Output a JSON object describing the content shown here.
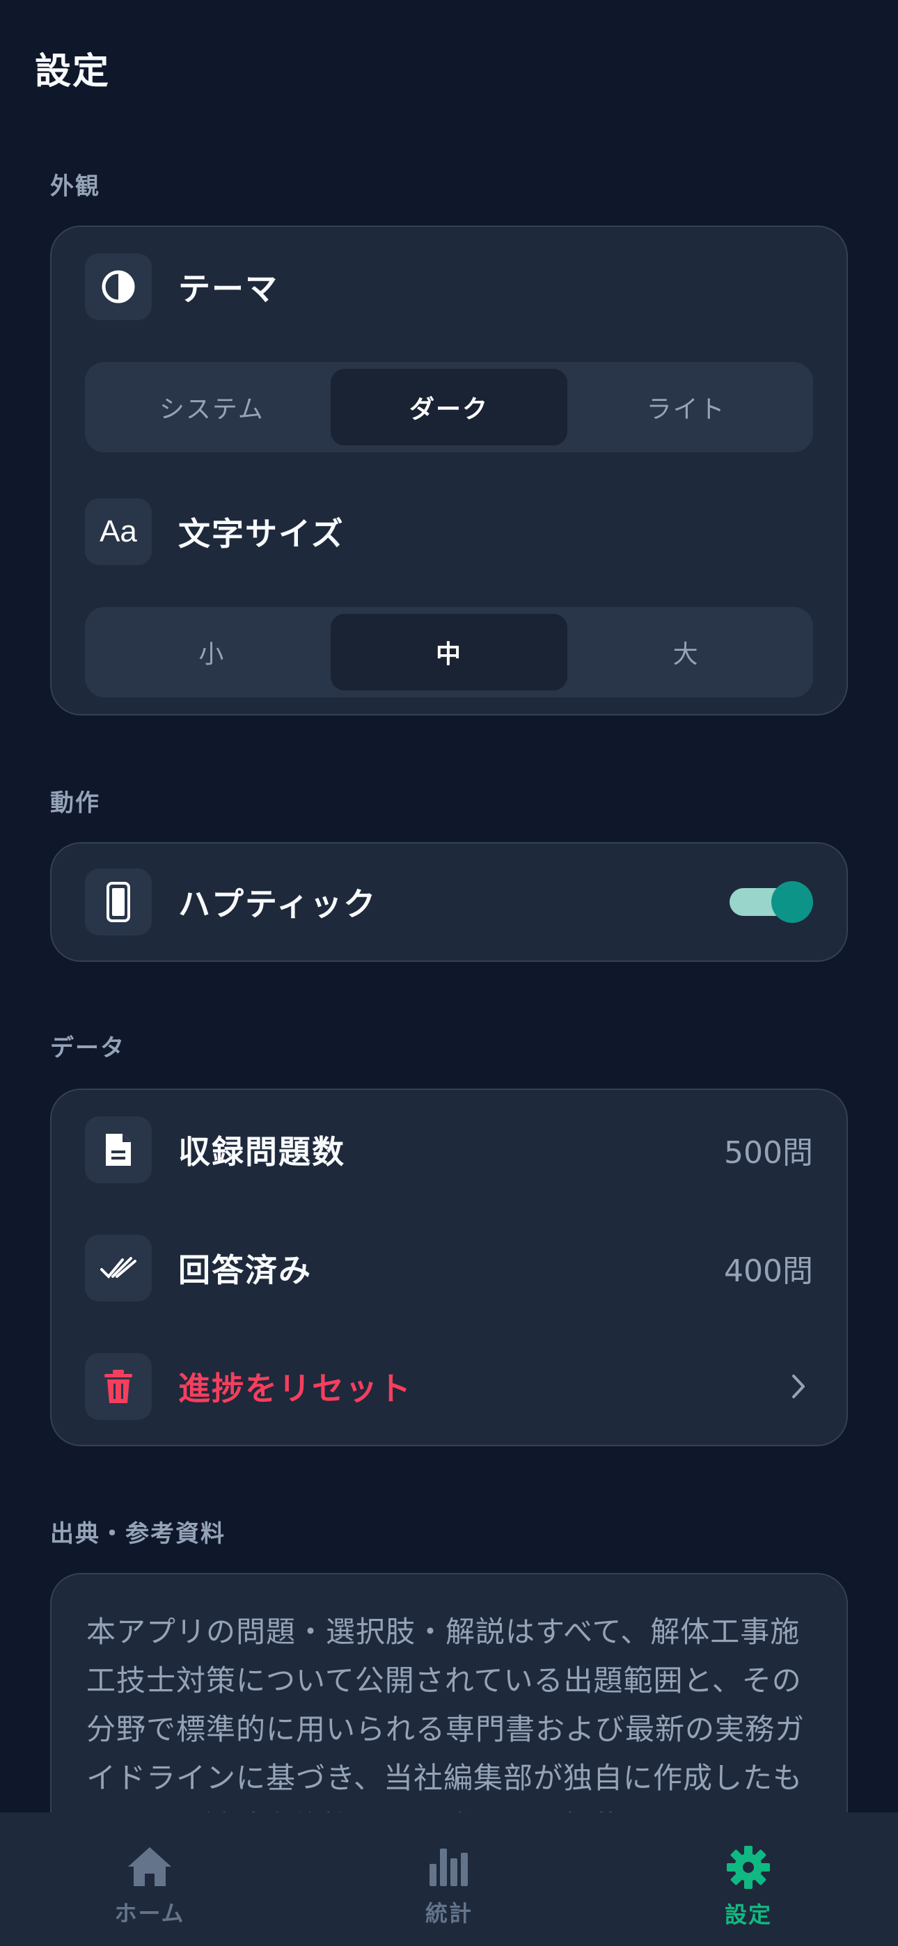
{
  "header": {
    "title": "設定"
  },
  "appearance": {
    "section_label": "外観",
    "theme": {
      "label": "テーマ",
      "icon": "contrast-icon",
      "options": [
        "システム",
        "ダーク",
        "ライト"
      ],
      "selected": "ダーク"
    },
    "font_size": {
      "label": "文字サイズ",
      "icon": "text-size-icon",
      "options": [
        "小",
        "中",
        "大"
      ],
      "selected": "中"
    }
  },
  "behavior": {
    "section_label": "動作",
    "haptic": {
      "label": "ハプティック",
      "icon": "phone-icon",
      "enabled": true
    }
  },
  "data": {
    "section_label": "データ",
    "question_count": {
      "label": "収録問題数",
      "value": "500問",
      "icon": "document-icon"
    },
    "answered": {
      "label": "回答済み",
      "value": "400問",
      "icon": "double-check-icon"
    },
    "reset": {
      "label": "進捗をリセット",
      "icon": "trash-icon"
    }
  },
  "sources": {
    "section_label": "出典・参考資料",
    "text": "本アプリの問題・選択肢・解説はすべて、解体工事施工技士対策について公開されている出題範囲と、その分野で標準的に用いられる専門書および最新の実務ガイドラインに基づき、当社編集部が独自に作成したものです。試験実施機関の公式問題を転載したものではありません。"
  },
  "tabbar": {
    "items": [
      {
        "label": "ホーム",
        "icon": "home-icon"
      },
      {
        "label": "統計",
        "icon": "bar-chart-icon"
      },
      {
        "label": "設定",
        "icon": "gear-icon"
      }
    ],
    "active": "設定"
  },
  "colors": {
    "background": "#0f172a",
    "card": "#1e293b",
    "accent": "#10b981",
    "toggle": "#0d9488",
    "danger": "#f43f5e"
  }
}
